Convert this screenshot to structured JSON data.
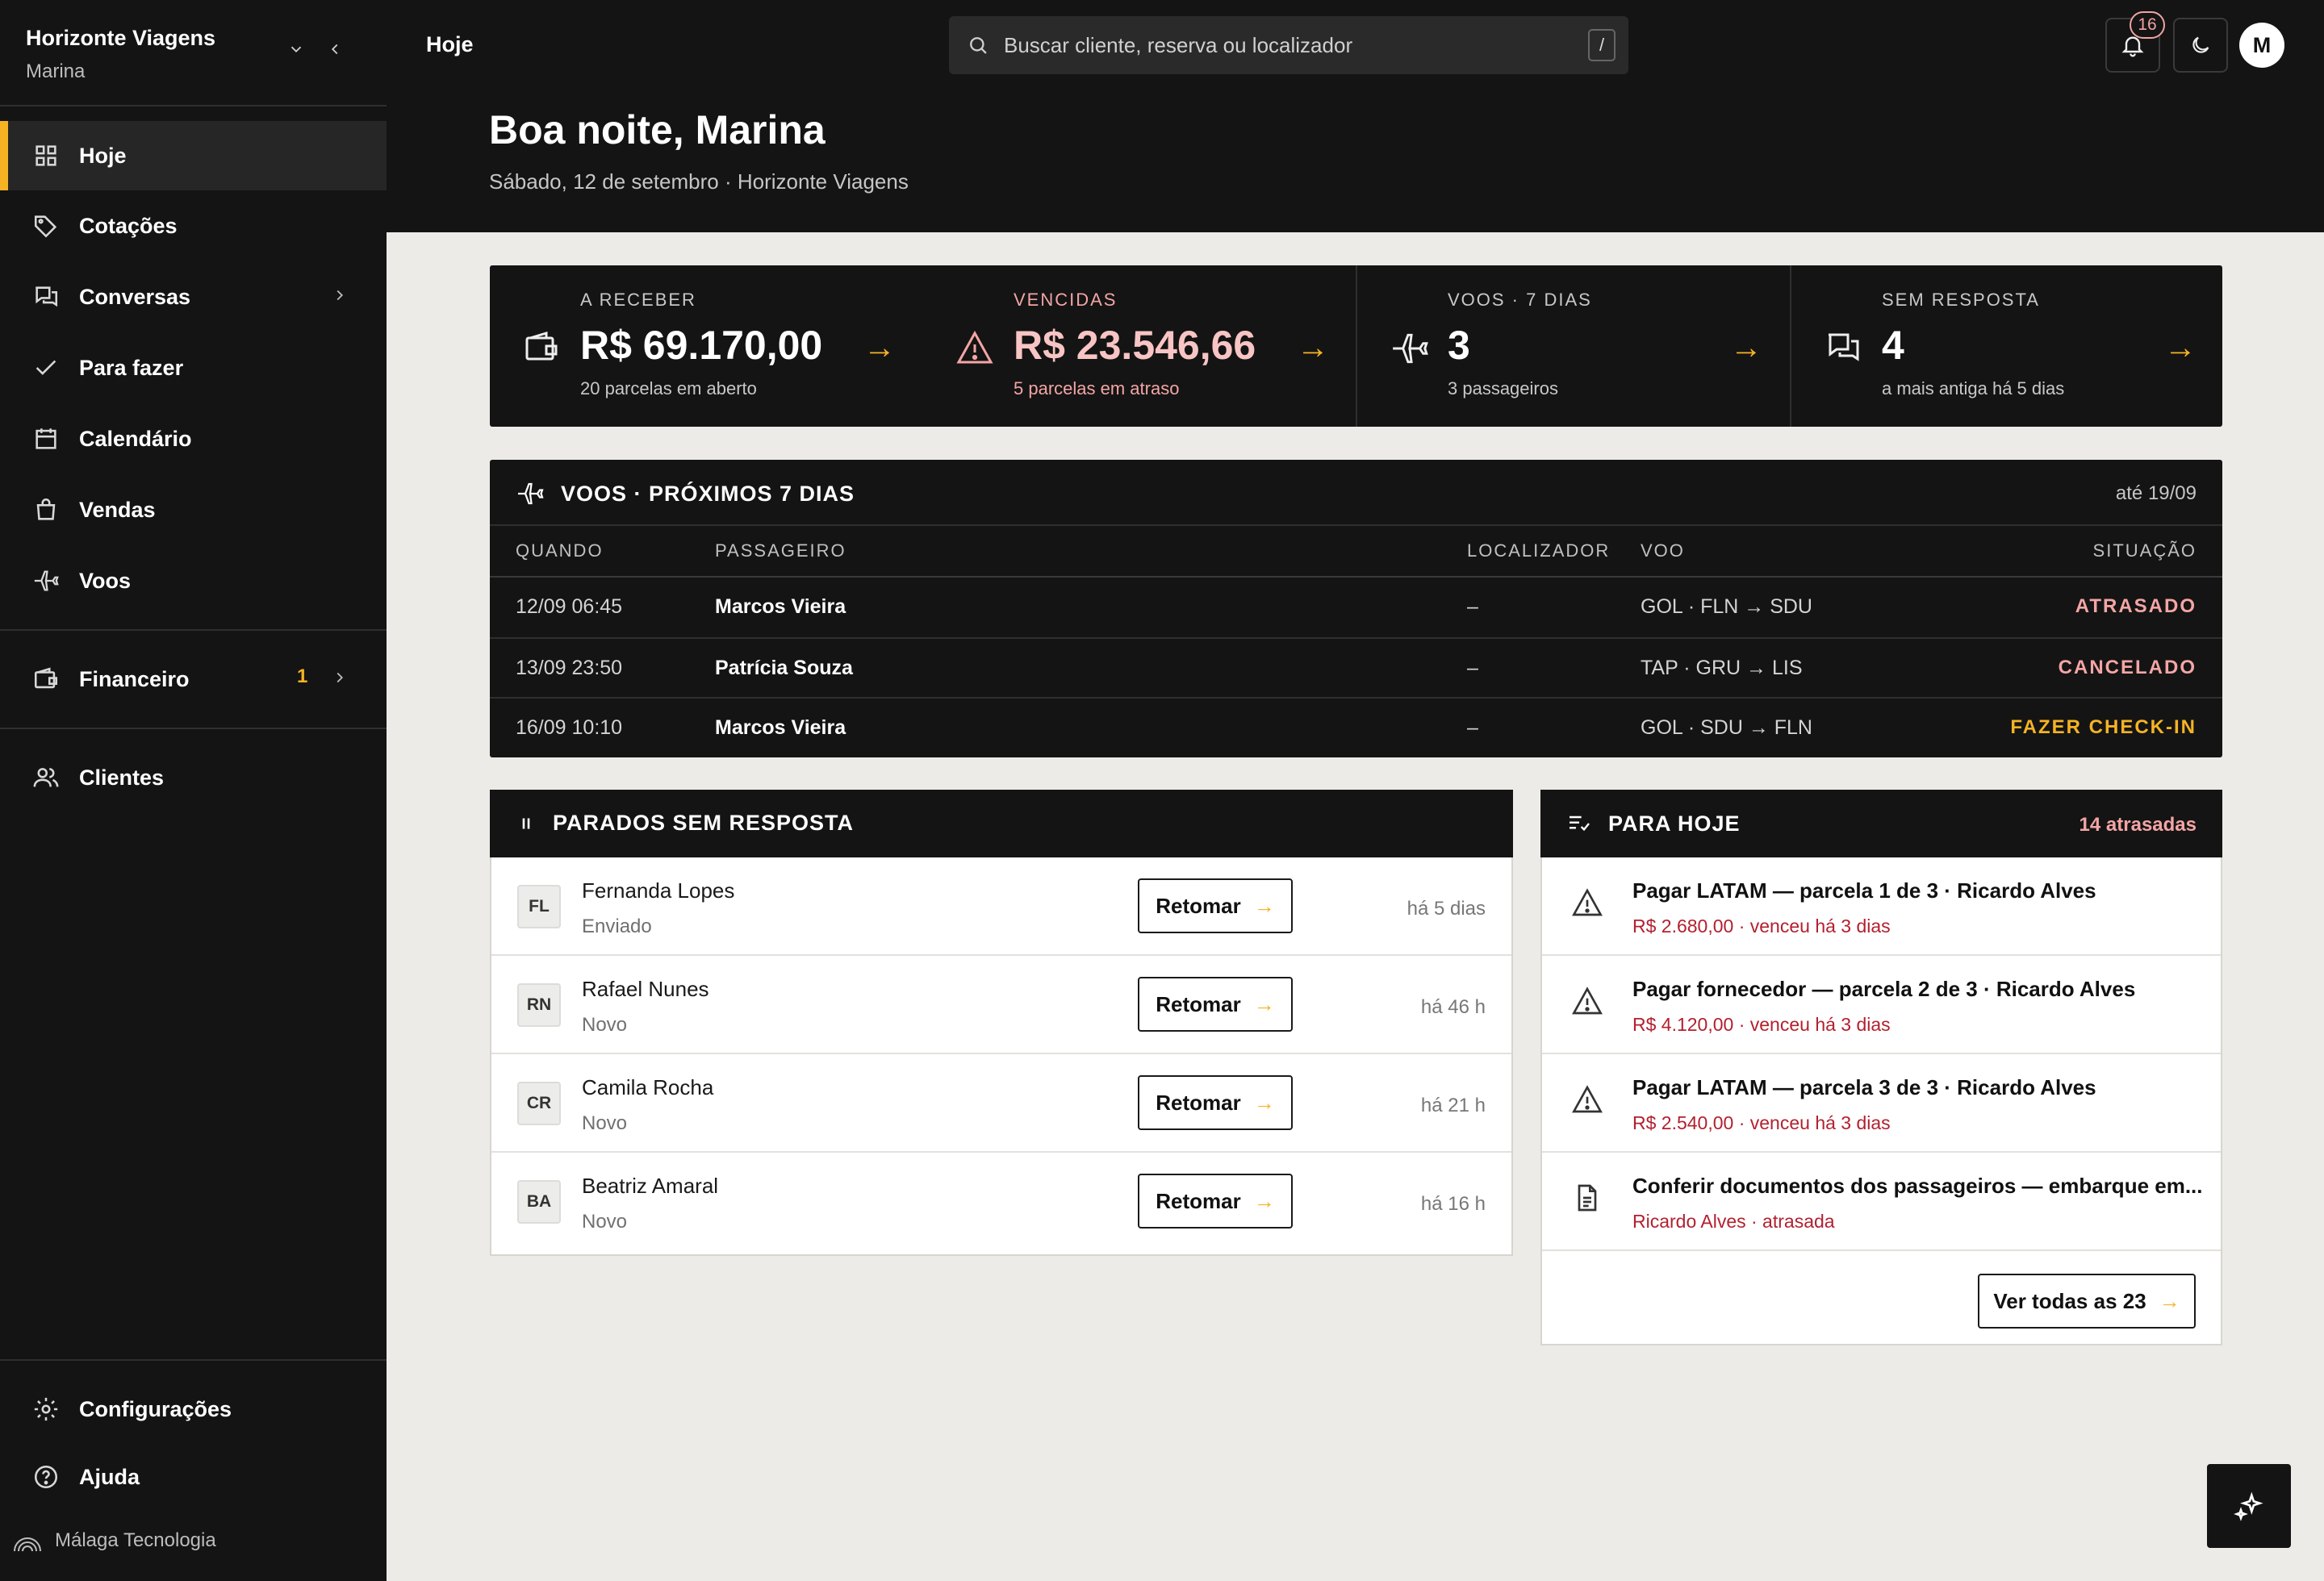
{
  "sidebar": {
    "brand_name": "Horizonte Viagens",
    "user_name": "Marina",
    "items": [
      {
        "label": "Hoje",
        "icon": "grid-icon"
      },
      {
        "label": "Cotações",
        "icon": "tag-icon"
      },
      {
        "label": "Conversas",
        "icon": "chat-icon"
      },
      {
        "label": "Para fazer",
        "icon": "check-icon"
      },
      {
        "label": "Calendário",
        "icon": "calendar-icon"
      },
      {
        "label": "Vendas",
        "icon": "bag-icon"
      },
      {
        "label": "Voos",
        "icon": "plane-icon"
      },
      {
        "label": "Financeiro",
        "icon": "wallet-icon",
        "badge": "1"
      },
      {
        "label": "Clientes",
        "icon": "users-icon"
      }
    ],
    "settings_label": "Configurações",
    "help_label": "Ajuda",
    "powered_by": "Málaga Tecnologia"
  },
  "header": {
    "page_label": "Hoje",
    "search_placeholder": "Buscar cliente, reserva ou localizador",
    "search_shortcut": "/",
    "notifications_count": "16",
    "avatar_initial": "M",
    "greeting": "Boa noite, Marina",
    "subtitle": "Sábado, 12 de setembro · Horizonte Viagens"
  },
  "stats": [
    {
      "label": "A RECEBER",
      "value": "R$ 69.170,00",
      "note": "20 parcelas em aberto",
      "arrow": "→"
    },
    {
      "label": "VENCIDAS",
      "value": "R$ 23.546,66",
      "note": "5 parcelas em atraso",
      "arrow": "→"
    },
    {
      "label": "VOOS · 7 DIAS",
      "value": "3",
      "note": "3 passageiros",
      "arrow": "→"
    },
    {
      "label": "SEM RESPOSTA",
      "value": "4",
      "note": "a mais antiga há 5 dias",
      "arrow": "→"
    }
  ],
  "flights": {
    "title": "VOOS · PRÓXIMOS 7 DIAS",
    "until": "até 19/09",
    "columns": [
      "QUANDO",
      "PASSAGEIRO",
      "LOCALIZADOR",
      "VOO",
      "SITUAÇÃO"
    ],
    "rows": [
      {
        "when": "12/09 06:45",
        "passenger": "Marcos Vieira",
        "locator": "–",
        "flight": "GOL · FLN → SDU",
        "status": "ATRASADO",
        "status_color": "#f4a5a5"
      },
      {
        "when": "13/09 23:50",
        "passenger": "Patrícia Souza",
        "locator": "–",
        "flight": "TAP · GRU → LIS",
        "status": "CANCELADO",
        "status_color": "#f4a5a5"
      },
      {
        "when": "16/09 10:10",
        "passenger": "Marcos Vieira",
        "locator": "–",
        "flight": "GOL · SDU → FLN",
        "status": "FAZER CHECK-IN",
        "status_color": "#f5b324"
      }
    ]
  },
  "stuck": {
    "title": "PARADOS SEM RESPOSTA",
    "button_label": "Retomar",
    "button_arrow": "→",
    "rows": [
      {
        "initials": "FL",
        "name": "Fernanda Lopes",
        "status": "Enviado",
        "time": "há 5 dias"
      },
      {
        "initials": "RN",
        "name": "Rafael Nunes",
        "status": "Novo",
        "time": "há 46 h"
      },
      {
        "initials": "CR",
        "name": "Camila Rocha",
        "status": "Novo",
        "time": "há 21 h"
      },
      {
        "initials": "BA",
        "name": "Beatriz Amaral",
        "status": "Novo",
        "time": "há 16 h"
      }
    ]
  },
  "today": {
    "title": "PARA HOJE",
    "late_count": "14 atrasadas",
    "tasks": [
      {
        "icon": "warning-icon",
        "title": "Pagar LATAM — parcela 1 de 3 · Ricardo Alves",
        "sub": "R$ 2.680,00 · venceu há 3 dias"
      },
      {
        "icon": "warning-icon",
        "title": "Pagar fornecedor — parcela 2 de 3 · Ricardo Alves",
        "sub": "R$ 4.120,00 · venceu há 3 dias"
      },
      {
        "icon": "warning-icon",
        "title": "Pagar LATAM — parcela 3 de 3 · Ricardo Alves",
        "sub": "R$ 2.540,00 · venceu há 3 dias"
      },
      {
        "icon": "document-icon",
        "title": "Conferir documentos dos passageiros — embarque em...",
        "sub": "Ricardo Alves · atrasada"
      }
    ],
    "see_all_label": "Ver todas as 23",
    "see_all_arrow": "→"
  },
  "colors": {
    "accent": "#f5b324",
    "danger": "#b3202f",
    "danger_light": "#f4a5a5",
    "dark": "#141414"
  }
}
